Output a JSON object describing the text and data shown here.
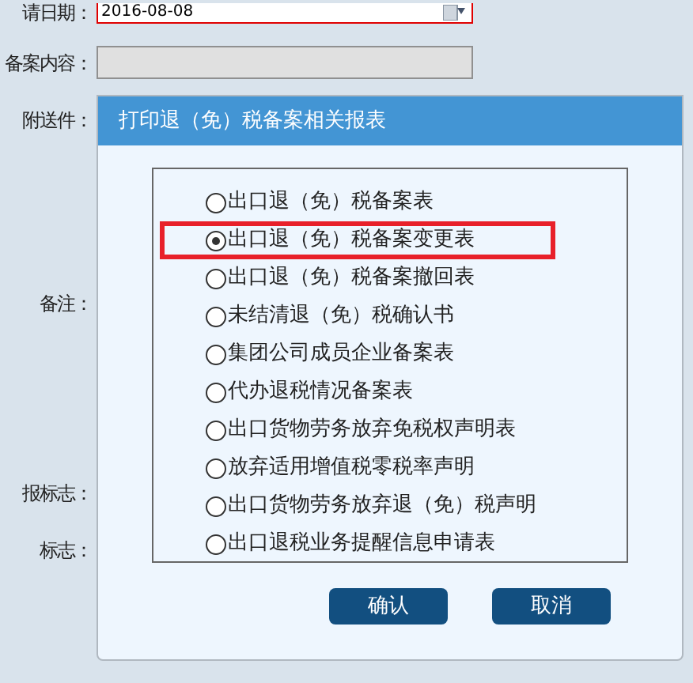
{
  "form": {
    "fields": [
      {
        "label": "请日期：",
        "kind": "date",
        "value": "2016-08-08"
      },
      {
        "label": "备案内容：",
        "kind": "readonly"
      },
      {
        "label": "附送件：",
        "kind": "plain"
      },
      {
        "label": "备注：",
        "kind": "plain"
      },
      {
        "label": "报标志：",
        "kind": "plain"
      },
      {
        "label": "标志：",
        "kind": "plain"
      }
    ]
  },
  "dialog": {
    "title": "打印退（免）税备案相关报表",
    "options": [
      {
        "label": "出口退（免）税备案表",
        "selected": false
      },
      {
        "label": "出口退（免）税备案变更表",
        "selected": true
      },
      {
        "label": "出口退（免）税备案撤回表",
        "selected": false
      },
      {
        "label": "未结清退（免）税确认书",
        "selected": false
      },
      {
        "label": "集团公司成员企业备案表",
        "selected": false
      },
      {
        "label": "代办退税情况备案表",
        "selected": false
      },
      {
        "label": "出口货物劳务放弃免税权声明表",
        "selected": false
      },
      {
        "label": "放弃适用增值税零税率声明",
        "selected": false
      },
      {
        "label": "出口货物劳务放弃退（免）税声明",
        "selected": false
      },
      {
        "label": "出口退税业务提醒信息申请表",
        "selected": false
      }
    ],
    "buttons": [
      "确认",
      "取消"
    ]
  }
}
